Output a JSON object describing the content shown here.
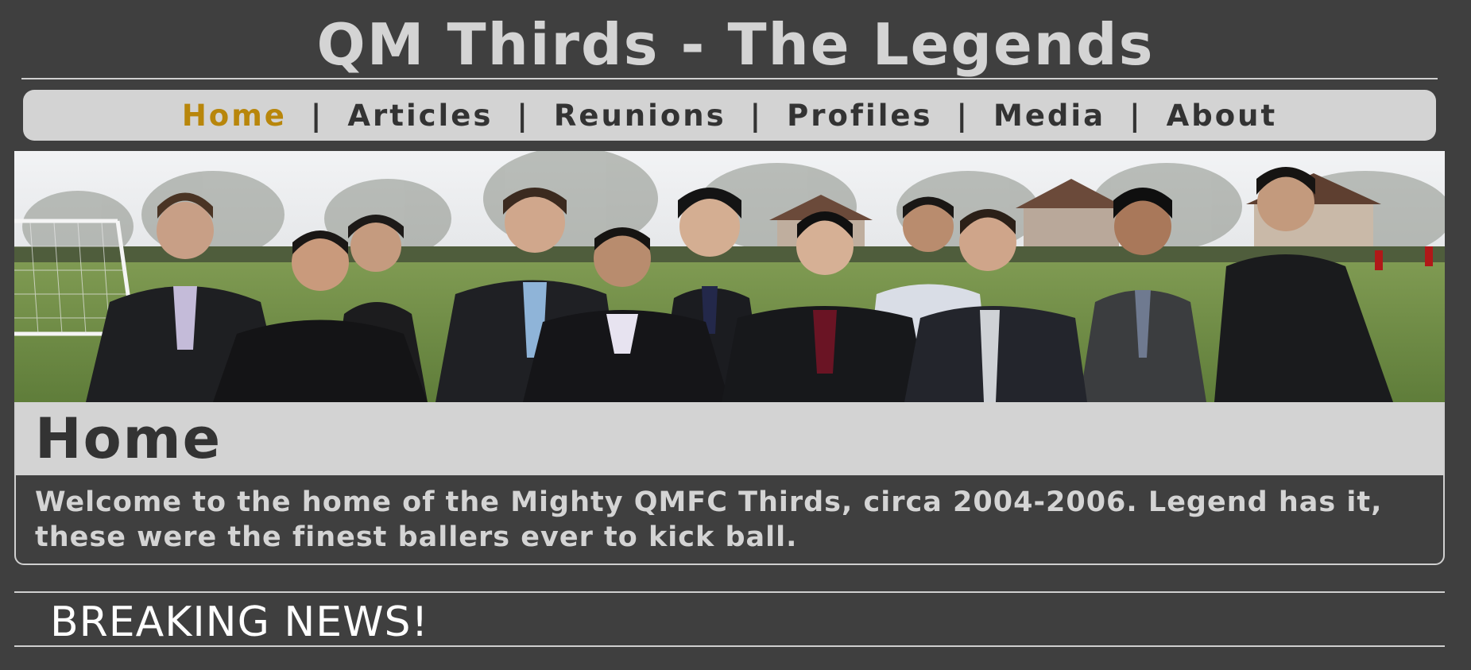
{
  "header": {
    "title": "QM Thirds - The Legends"
  },
  "nav": {
    "items": [
      {
        "label": "Home",
        "active": true
      },
      {
        "label": "Articles",
        "active": false
      },
      {
        "label": "Reunions",
        "active": false
      },
      {
        "label": "Profiles",
        "active": false
      },
      {
        "label": "Media",
        "active": false
      },
      {
        "label": "About",
        "active": false
      }
    ],
    "separator": "|"
  },
  "hero": {
    "description": "Group photo of the team in suits standing on a football field"
  },
  "main": {
    "heading": "Home",
    "welcome": "Welcome to the home of the Mighty QMFC Thirds, circa 2004-2006. Legend has it, these were the finest ballers ever to kick ball."
  },
  "news": {
    "heading": "BREAKING NEWS!"
  },
  "colors": {
    "background": "#3f3f3f",
    "panel": "#d3d3d3",
    "text_light": "#d4d4d4",
    "text_dark": "#333333",
    "active_link": "#b8860b"
  }
}
